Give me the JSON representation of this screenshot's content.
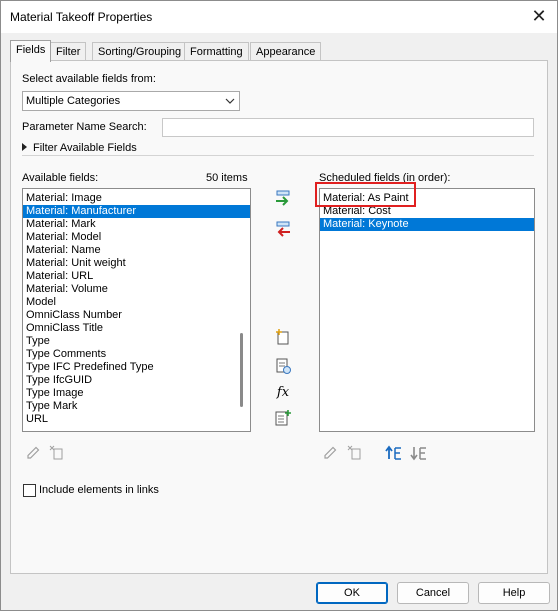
{
  "window": {
    "title": "Material Takeoff Properties",
    "close_glyph": "✕"
  },
  "tabs": [
    {
      "label": "Fields"
    },
    {
      "label": "Filter"
    },
    {
      "label": "Sorting/Grouping"
    },
    {
      "label": "Formatting"
    },
    {
      "label": "Appearance"
    }
  ],
  "fields_from": {
    "label": "Select available fields from:",
    "value": "Multiple Categories"
  },
  "param_search": {
    "label": "Parameter Name Search:",
    "value": ""
  },
  "filter_expander": {
    "label": "Filter Available Fields"
  },
  "available": {
    "label": "Available fields:",
    "count": "50 items",
    "items": [
      "Material: Image",
      "Material: Manufacturer",
      "Material: Mark",
      "Material: Model",
      "Material: Name",
      "Material: Unit weight",
      "Material: URL",
      "Material: Volume",
      "Model",
      "OmniClass Number",
      "OmniClass Title",
      "Type",
      "Type Comments",
      "Type IFC Predefined Type",
      "Type IfcGUID",
      "Type Image",
      "Type Mark",
      "URL"
    ],
    "selected_index": 1
  },
  "scheduled": {
    "label": "Scheduled fields (in order):",
    "items": [
      "Material: As Paint",
      "Material: Cost",
      "Material: Keynote"
    ],
    "selected_index": 2
  },
  "middle_icons": [
    "add-parameter-icon",
    "remove-parameter-icon",
    "new-parameter-icon",
    "add-calculated-parameter-icon",
    "fx-icon",
    "combine-parameters-icon"
  ],
  "fx_label": "fx",
  "include_links": {
    "label": "Include elements in links",
    "checked": false
  },
  "buttons": {
    "ok": "OK",
    "cancel": "Cancel",
    "help": "Help"
  },
  "colors": {
    "selection": "#0078d7",
    "highlight": "#e02020",
    "accent": "#0067c0"
  }
}
